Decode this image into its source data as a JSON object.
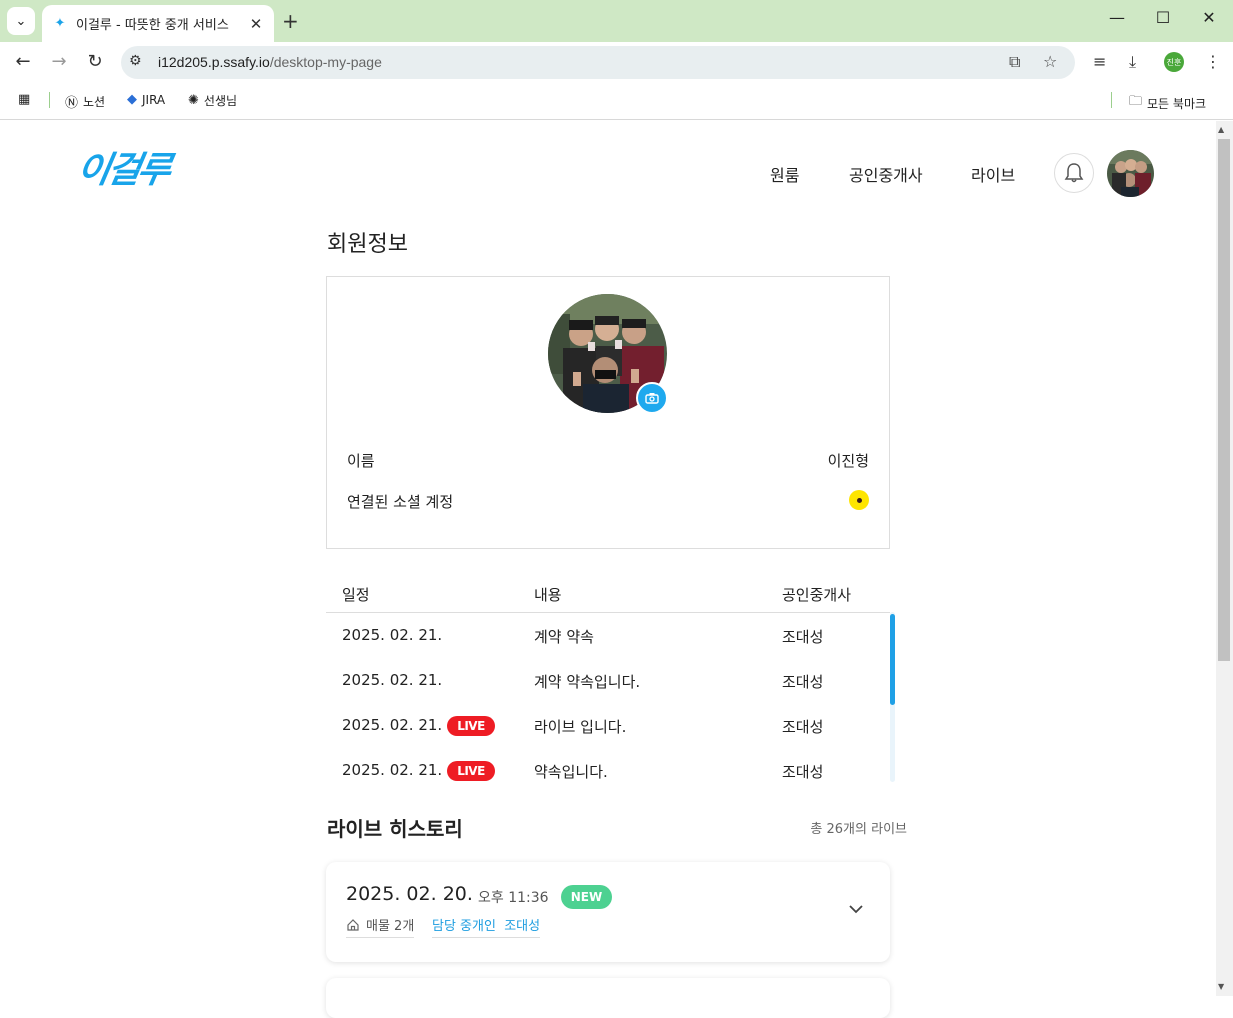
{
  "browser": {
    "tab_title": "이걸루 - 따뜻한 중개 서비스",
    "url_host": "i12d205.p.ssafy.io",
    "url_path": "/desktop-my-page",
    "profile_initials": "진훈",
    "bookmarks": [
      {
        "label": "노션"
      },
      {
        "label": "JIRA"
      },
      {
        "label": "선생님"
      }
    ],
    "all_bookmarks_label": "모든 북마크"
  },
  "header": {
    "logo_text": "이걸루",
    "nav": [
      "원룸",
      "공인중개사",
      "라이브"
    ]
  },
  "member_info": {
    "title": "회원정보",
    "name_label": "이름",
    "name_value": "이진형",
    "social_label": "연결된 소셜 계정"
  },
  "schedule": {
    "headers": [
      "일정",
      "내용",
      "공인중개사"
    ],
    "live_label": "LIVE",
    "rows": [
      {
        "date": "2025. 02. 21.",
        "content": "계약 약속",
        "agent": "조대성",
        "live": false
      },
      {
        "date": "2025. 02. 21.",
        "content": "계약 약속입니다.",
        "agent": "조대성",
        "live": false
      },
      {
        "date": "2025. 02. 21.",
        "content": "라이브 입니다.",
        "agent": "조대성",
        "live": true
      },
      {
        "date": "2025. 02. 21.",
        "content": "약속입니다.",
        "agent": "조대성",
        "live": true
      }
    ]
  },
  "live_history": {
    "title": "라이브 히스토리",
    "count_text": "총 26개의 라이브",
    "items": [
      {
        "date": "2025. 02. 20.",
        "time": "오후 11:36",
        "badge": "NEW",
        "props": "매물 2개",
        "agent_label": "담당 중개인",
        "agent_name": "조대성"
      }
    ]
  },
  "colors": {
    "accent": "#1fa9ee",
    "live": "#ee1c24",
    "new": "#4dd191",
    "kakao": "#fee500"
  }
}
